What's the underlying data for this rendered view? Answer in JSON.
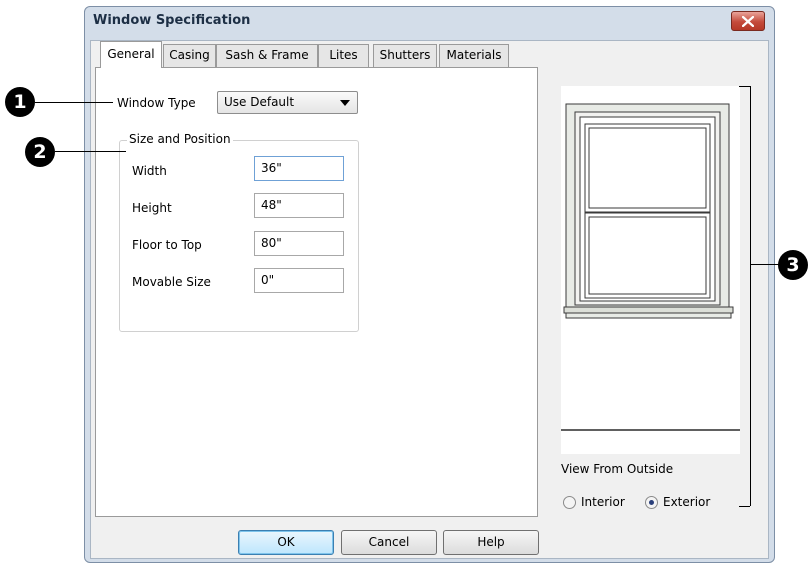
{
  "dialog": {
    "title": "Window Specification",
    "tabs": [
      "General",
      "Casing",
      "Sash & Frame",
      "Lites",
      "Shutters",
      "Materials"
    ],
    "active_tab": "General"
  },
  "general": {
    "window_type_label": "Window Type",
    "window_type_value": "Use Default",
    "size_group_title": "Size and Position",
    "fields": [
      {
        "label": "Width",
        "value": "36\""
      },
      {
        "label": "Height",
        "value": "48\""
      },
      {
        "label": "Floor to Top",
        "value": "80\""
      },
      {
        "label": "Movable Size",
        "value": "0\""
      }
    ]
  },
  "preview": {
    "view_label": "View From Outside",
    "options": [
      {
        "label": "Interior",
        "checked": false
      },
      {
        "label": "Exterior",
        "checked": true
      }
    ]
  },
  "buttons": {
    "ok": "OK",
    "cancel": "Cancel",
    "help": "Help"
  },
  "callouts": [
    "1",
    "2",
    "3"
  ],
  "colors": {
    "title_text": "#1d2f45",
    "frame": "#d3dde9",
    "close": "#c44b3b",
    "default_button": "#bee6fd"
  }
}
